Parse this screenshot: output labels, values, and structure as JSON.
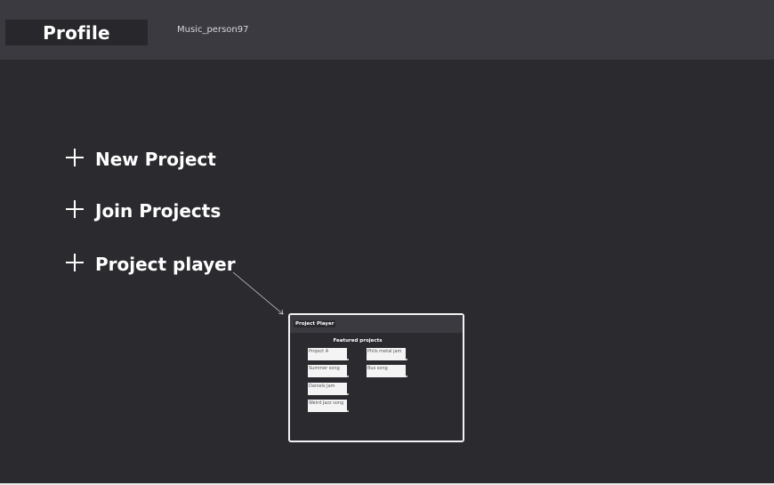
{
  "header": {
    "title": "Profile",
    "username": "Music_person97"
  },
  "menu": [
    {
      "label": "New Project",
      "icon": "plus-icon"
    },
    {
      "label": "Join Projects",
      "icon": "plus-icon"
    },
    {
      "label": "Project player",
      "icon": "plus-icon"
    }
  ],
  "player": {
    "title": "Project Player",
    "featured_heading": "Featured projects",
    "projects_left": [
      "Project A",
      "Summer song",
      "Daniels Jam",
      "Weird Jazz song"
    ],
    "projects_right": [
      "Phils metal jam",
      "Bus song"
    ]
  },
  "colors": {
    "background": "#2b2a2f",
    "header": "#3b3a40",
    "text": "#ffffff"
  }
}
